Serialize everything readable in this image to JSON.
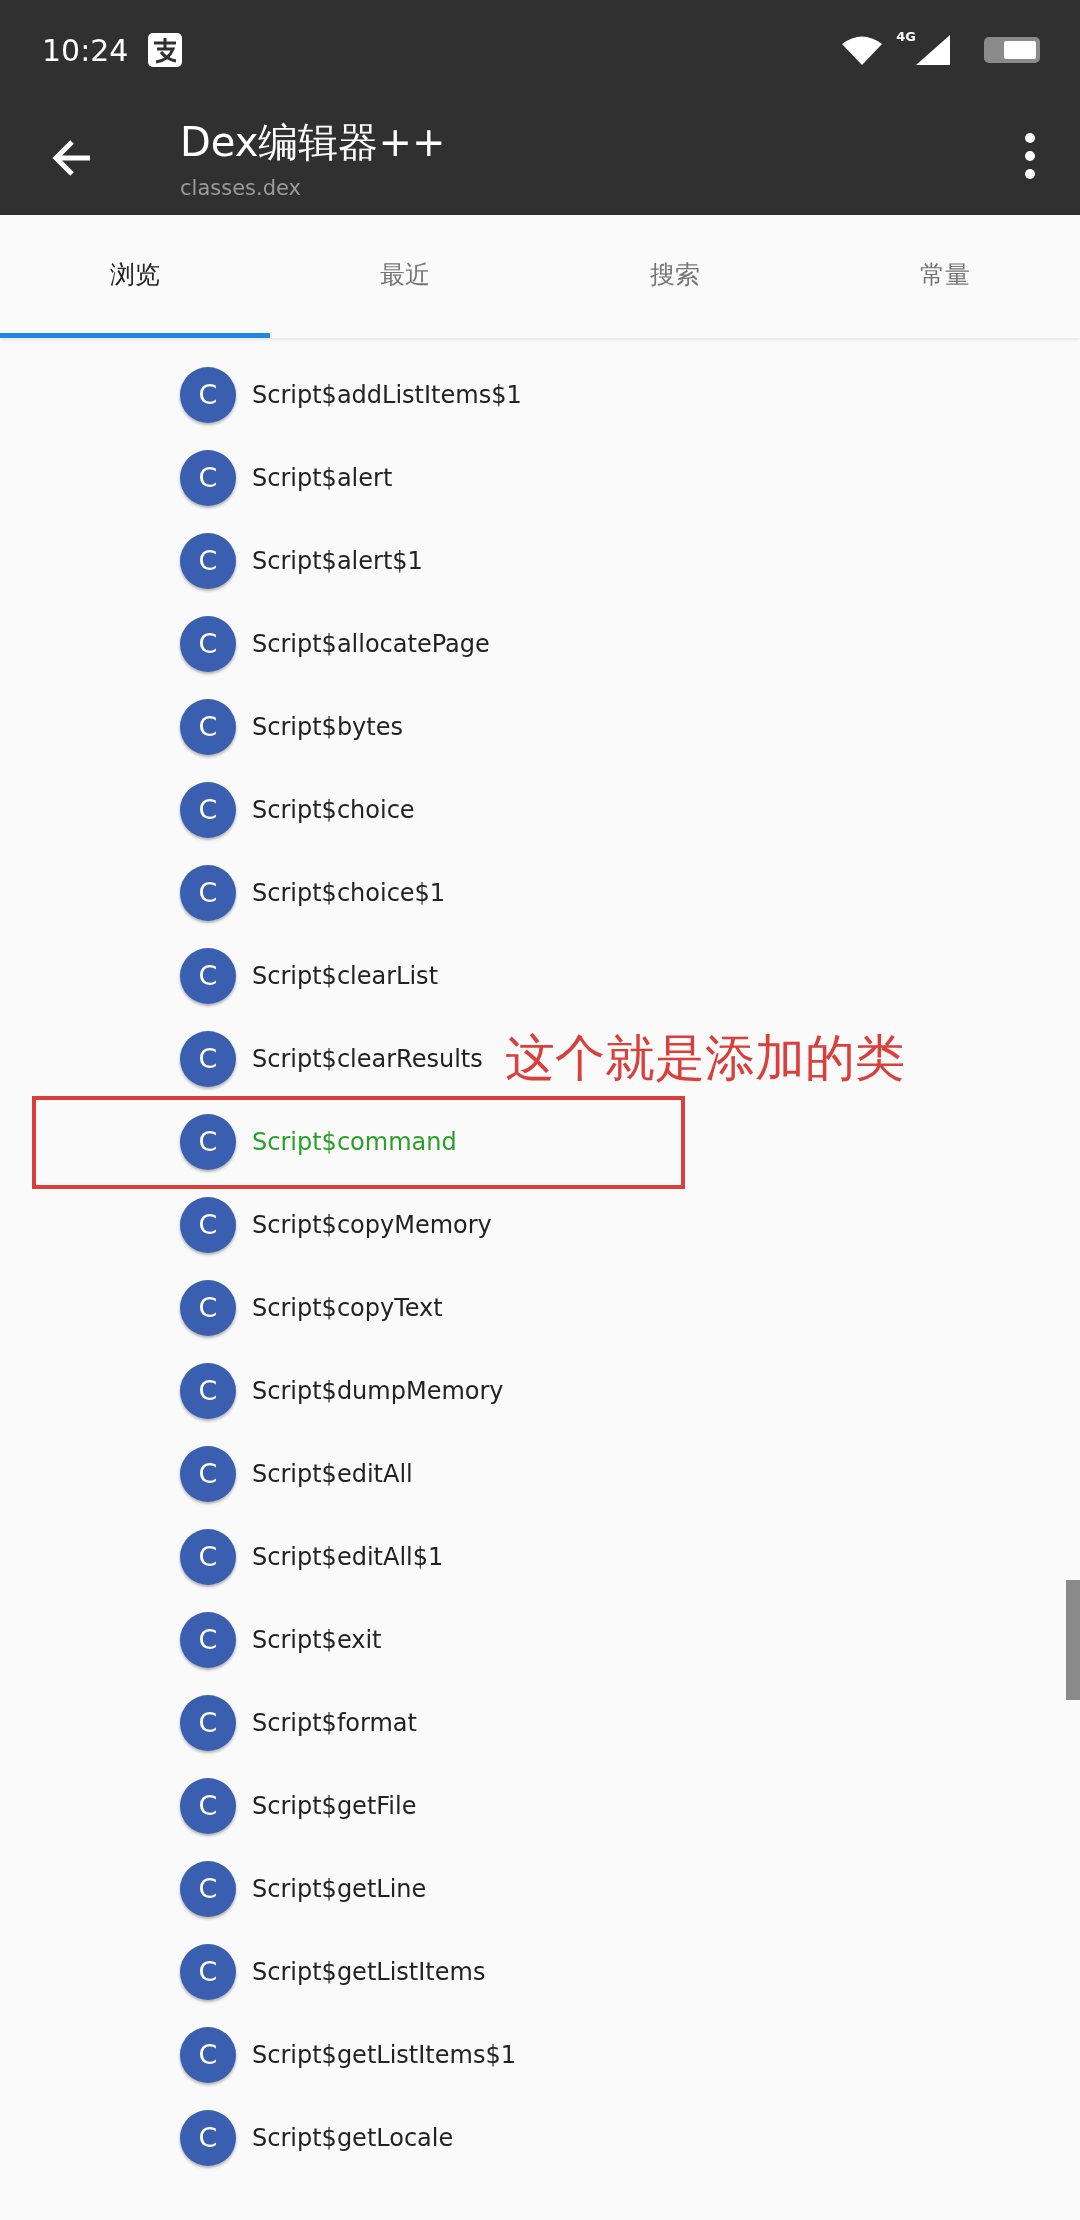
{
  "status_bar": {
    "time": "10:24",
    "network": "4G"
  },
  "toolbar": {
    "title": "Dex编辑器++",
    "subtitle": "classes.dex"
  },
  "tabs": [
    {
      "label": "浏览",
      "selected": true
    },
    {
      "label": "最近",
      "selected": false
    },
    {
      "label": "搜索",
      "selected": false
    },
    {
      "label": "常量",
      "selected": false
    }
  ],
  "classes": [
    {
      "badge": "C",
      "name": "Script$addListItems$1",
      "highlighted": false,
      "framed": false
    },
    {
      "badge": "C",
      "name": "Script$alert",
      "highlighted": false,
      "framed": false
    },
    {
      "badge": "C",
      "name": "Script$alert$1",
      "highlighted": false,
      "framed": false
    },
    {
      "badge": "C",
      "name": "Script$allocatePage",
      "highlighted": false,
      "framed": false
    },
    {
      "badge": "C",
      "name": "Script$bytes",
      "highlighted": false,
      "framed": false
    },
    {
      "badge": "C",
      "name": "Script$choice",
      "highlighted": false,
      "framed": false
    },
    {
      "badge": "C",
      "name": "Script$choice$1",
      "highlighted": false,
      "framed": false
    },
    {
      "badge": "C",
      "name": "Script$clearList",
      "highlighted": false,
      "framed": false
    },
    {
      "badge": "C",
      "name": "Script$clearResults",
      "highlighted": false,
      "framed": false,
      "note": "这个就是添加的类"
    },
    {
      "badge": "C",
      "name": "Script$command",
      "highlighted": true,
      "framed": true
    },
    {
      "badge": "C",
      "name": "Script$copyMemory",
      "highlighted": false,
      "framed": false
    },
    {
      "badge": "C",
      "name": "Script$copyText",
      "highlighted": false,
      "framed": false
    },
    {
      "badge": "C",
      "name": "Script$dumpMemory",
      "highlighted": false,
      "framed": false
    },
    {
      "badge": "C",
      "name": "Script$editAll",
      "highlighted": false,
      "framed": false
    },
    {
      "badge": "C",
      "name": "Script$editAll$1",
      "highlighted": false,
      "framed": false
    },
    {
      "badge": "C",
      "name": "Script$exit",
      "highlighted": false,
      "framed": false
    },
    {
      "badge": "C",
      "name": "Script$format",
      "highlighted": false,
      "framed": false
    },
    {
      "badge": "C",
      "name": "Script$getFile",
      "highlighted": false,
      "framed": false
    },
    {
      "badge": "C",
      "name": "Script$getLine",
      "highlighted": false,
      "framed": false
    },
    {
      "badge": "C",
      "name": "Script$getListItems",
      "highlighted": false,
      "framed": false
    },
    {
      "badge": "C",
      "name": "Script$getListItems$1",
      "highlighted": false,
      "framed": false
    },
    {
      "badge": "C",
      "name": "Script$getLocale",
      "highlighted": false,
      "framed": false
    }
  ]
}
